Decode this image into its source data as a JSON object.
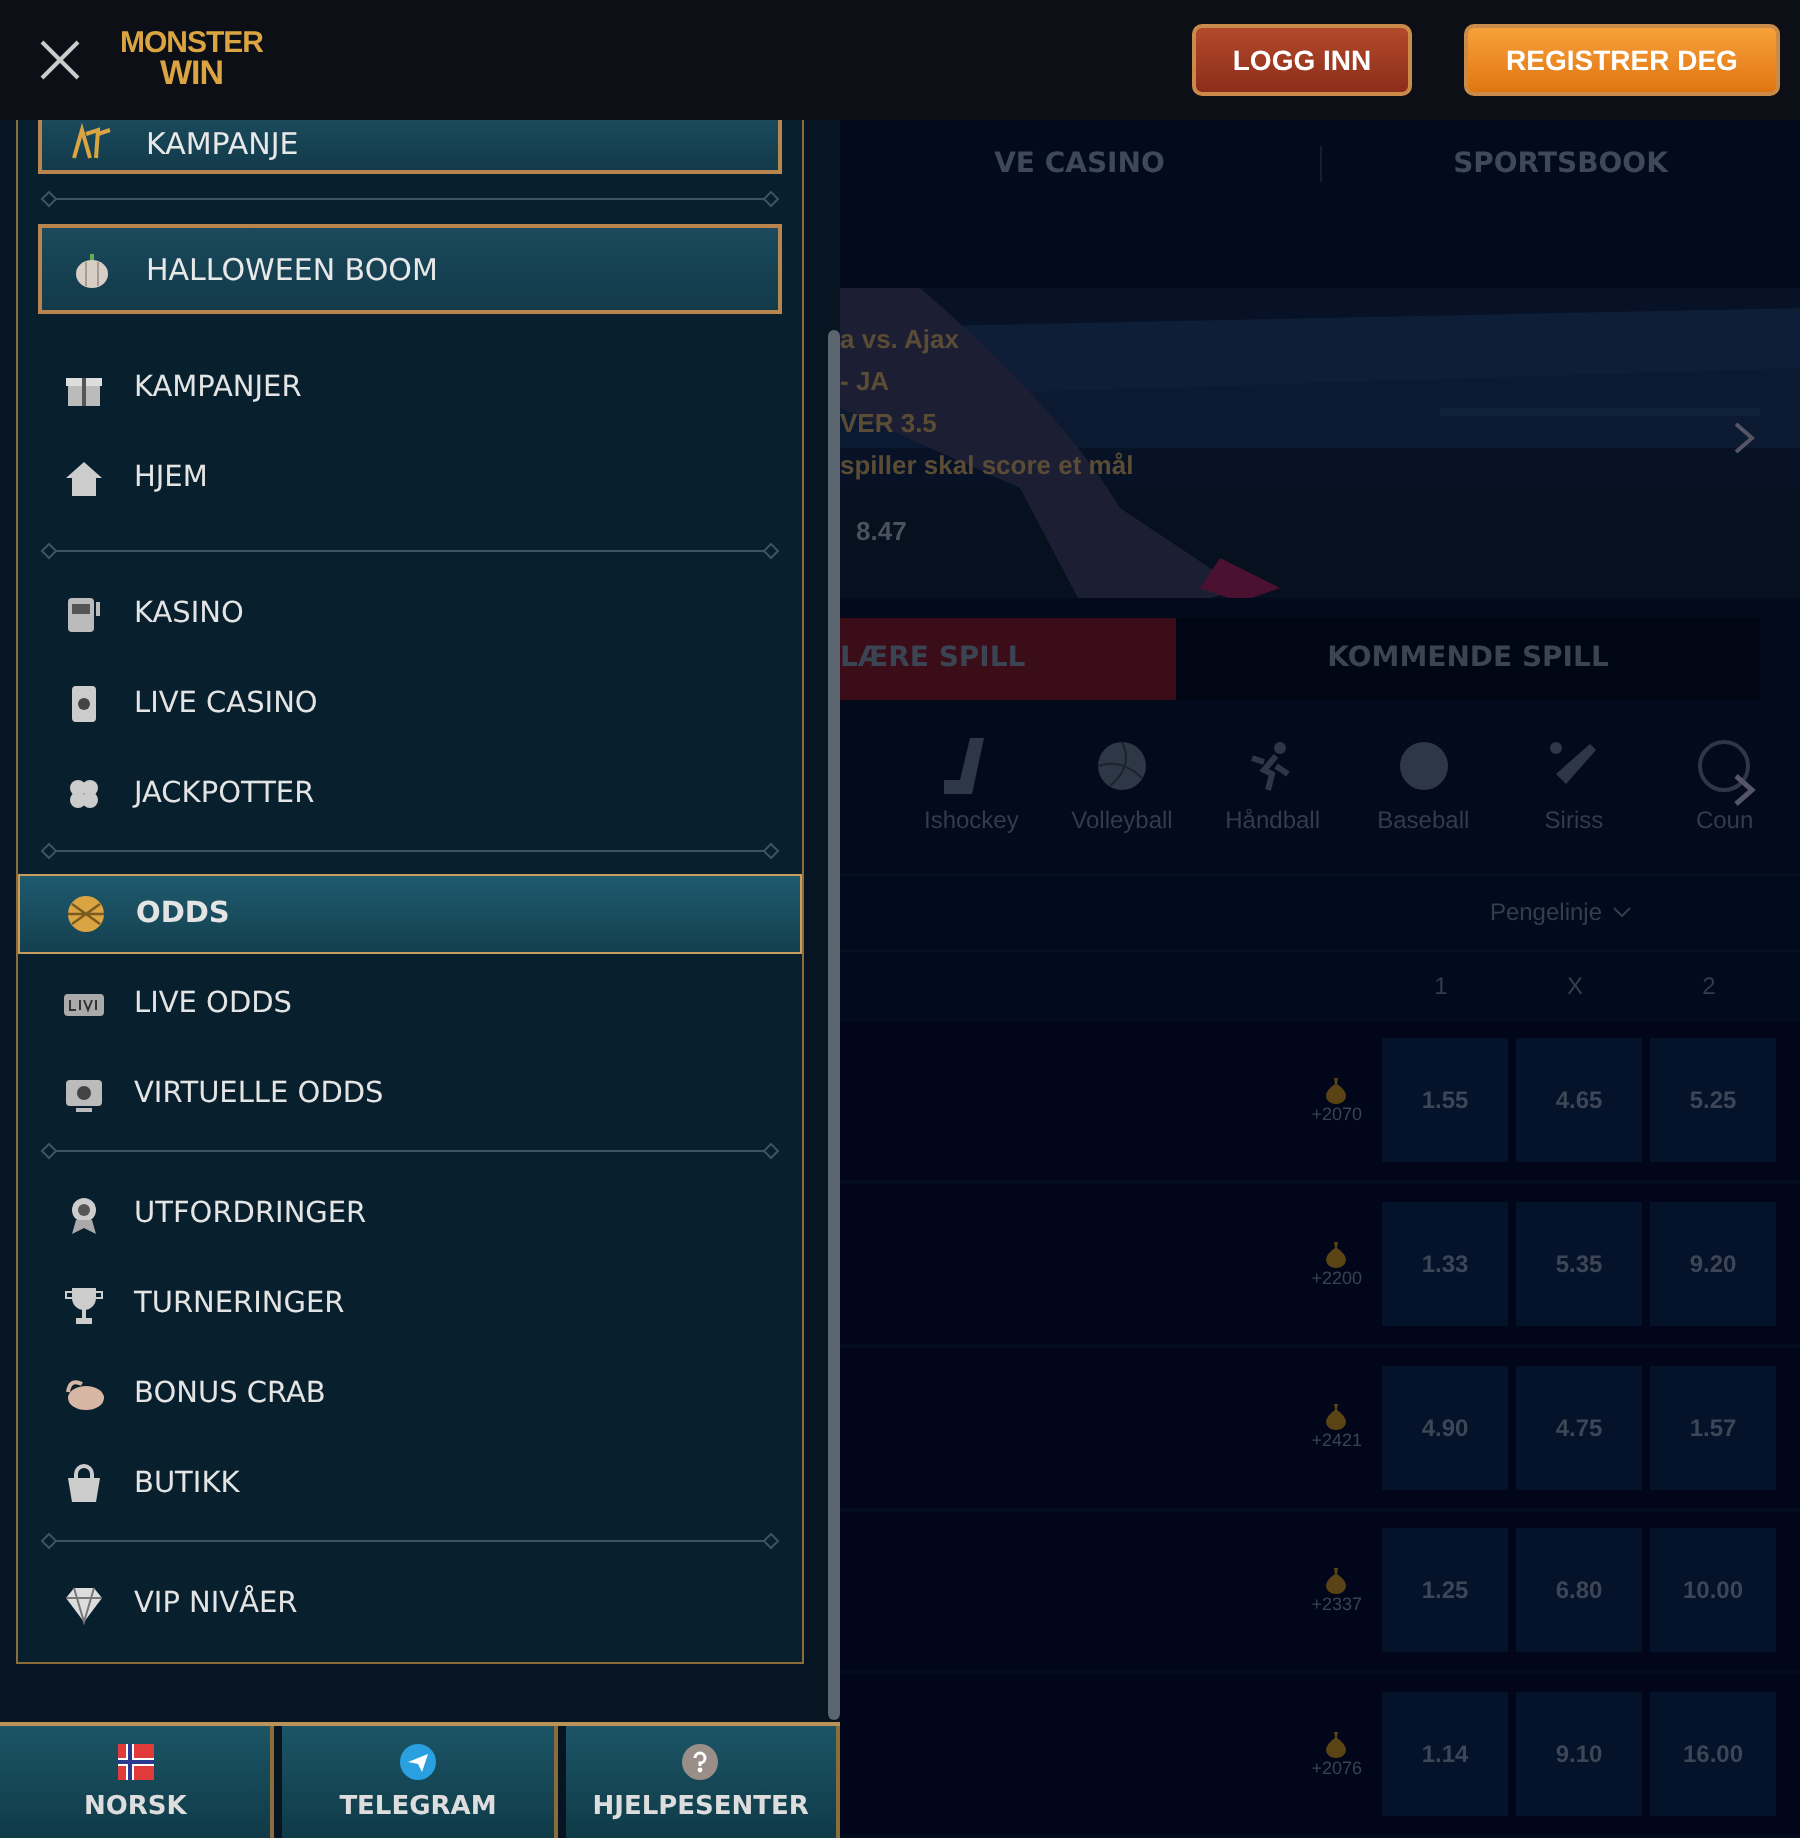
{
  "header": {
    "logo_top": "MONSTER",
    "logo_bottom": "WIN",
    "buttons": [
      {
        "label": "LOGG INN",
        "kind": "login"
      },
      {
        "label": "REGISTRER DEG",
        "kind": "register"
      }
    ]
  },
  "menu": {
    "promos": [
      {
        "label": "KAMPANJE"
      },
      {
        "label": "HALLOWEEN BOOM"
      }
    ],
    "groups": [
      {
        "items": [
          {
            "label": "KAMPANJER",
            "selected": false
          },
          {
            "label": "HJEM",
            "selected": false
          }
        ]
      },
      {
        "items": [
          {
            "label": "KASINO",
            "selected": false
          },
          {
            "label": "LIVE CASINO",
            "selected": false
          },
          {
            "label": "JACKPOTTER",
            "selected": false
          }
        ]
      },
      {
        "items": [
          {
            "label": "ODDS",
            "selected": true
          },
          {
            "label": "LIVE ODDS",
            "selected": false
          },
          {
            "label": "VIRTUELLE ODDS",
            "selected": false
          }
        ]
      },
      {
        "items": [
          {
            "label": "UTFORDRINGER",
            "selected": false
          },
          {
            "label": "TURNERINGER",
            "selected": false
          },
          {
            "label": "BONUS CRAB",
            "selected": false
          },
          {
            "label": "BUTIKK",
            "selected": false
          }
        ]
      },
      {
        "items": [
          {
            "label": "VIP NIVÅER",
            "selected": false
          }
        ]
      }
    ]
  },
  "footer": [
    {
      "label": "NORSK"
    },
    {
      "label": "TELEGRAM"
    },
    {
      "label": "HJELPESENTER"
    }
  ],
  "main": {
    "tabs": [
      {
        "label": "VE CASINO"
      },
      {
        "label": "SPORTSBOOK"
      }
    ],
    "banner": {
      "lines": [
        "a  vs.  Ajax",
        "- JA",
        "VER 3.5",
        "spiller skal score et mål"
      ],
      "odds": "8.47"
    },
    "game_tabs": [
      {
        "label": "LÆRE SPILL",
        "selected": true
      },
      {
        "label": "KOMMENDE SPILL",
        "selected": false
      }
    ],
    "sports": [
      {
        "label": "Ishockey"
      },
      {
        "label": "Volleyball"
      },
      {
        "label": "Håndball"
      },
      {
        "label": "Baseball"
      },
      {
        "label": "Siriss"
      },
      {
        "label": "Coun"
      }
    ],
    "market": "Pengelinje",
    "columns": [
      "1",
      "X",
      "2"
    ],
    "rows": [
      {
        "boost": "+2070",
        "odds": [
          "1.55",
          "4.65",
          "5.25"
        ]
      },
      {
        "boost": "+2200",
        "odds": [
          "1.33",
          "5.35",
          "9.20"
        ]
      },
      {
        "boost": "+2421",
        "odds": [
          "4.90",
          "4.75",
          "1.57"
        ]
      },
      {
        "boost": "+2337",
        "odds": [
          "1.25",
          "6.80",
          "10.00"
        ]
      },
      {
        "boost": "+2076",
        "odds": [
          "1.14",
          "9.10",
          "16.00"
        ]
      }
    ]
  }
}
